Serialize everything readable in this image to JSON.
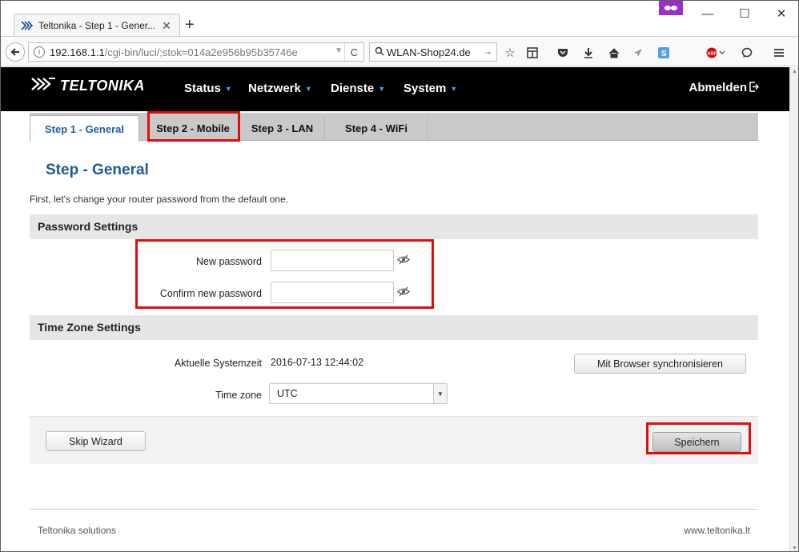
{
  "browser": {
    "tab_title": "Teltonika - Step 1 - Gener...",
    "tab_close": "✕",
    "new_tab": "+",
    "url_host": "192.168.1.1",
    "url_path": "/cgi-bin/luci/;stok=014a2e956b95b35746e",
    "search_text": "WLAN-Shop24.de",
    "window_controls": {
      "minimize": "—",
      "maximize": "☐",
      "close": "✕"
    },
    "toolbar_icons": [
      "star-icon",
      "reader-icon",
      "pocket-icon",
      "download-icon",
      "home-icon",
      "send-icon",
      "s-icon",
      "abp-icon",
      "chat-icon",
      "menu-icon"
    ],
    "abp_label": "ABP"
  },
  "nav": {
    "brand": "TELTONIKA",
    "menu": [
      "Status",
      "Netzwerk",
      "Dienste",
      "System"
    ],
    "logout": "Abmelden"
  },
  "steps": [
    {
      "label": "Step 1 - General",
      "active": true
    },
    {
      "label": "Step 2 - Mobile",
      "active": false
    },
    {
      "label": "Step 3 - LAN",
      "active": false
    },
    {
      "label": "Step 4 - WiFi",
      "active": false
    }
  ],
  "main": {
    "heading": "Step - General",
    "intro": "First, let's change your router password from the default one.",
    "password_section": {
      "title": "Password Settings",
      "new_password_label": "New password",
      "new_password_value": "",
      "confirm_password_label": "Confirm new password",
      "confirm_password_value": ""
    },
    "time_section": {
      "title": "Time Zone Settings",
      "system_time_label": "Aktuelle Systemzeit",
      "system_time_value": "2016-07-13 12:44:02",
      "sync_button": "Mit Browser synchronisieren",
      "timezone_label": "Time zone",
      "timezone_value": "UTC"
    },
    "skip_button": "Skip Wizard",
    "save_button": "Speichern"
  },
  "footer": {
    "left": "Teltonika solutions",
    "right": "www.teltonika.lt"
  },
  "colors": {
    "highlight_box": "#e20c0c",
    "heading_blue": "#1f5a96",
    "nav_background": "#000000",
    "menu_caret": "#4a9bd8"
  }
}
